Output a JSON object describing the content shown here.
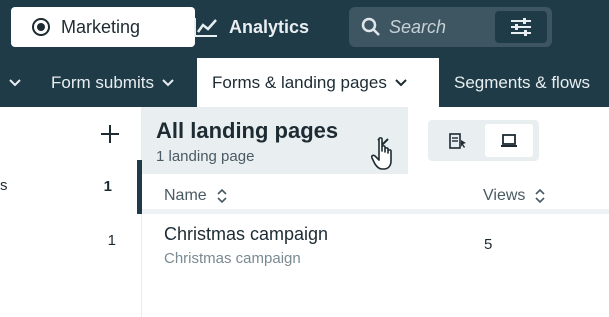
{
  "topbar": {
    "marketing_label": "Marketing",
    "analytics_label": "Analytics",
    "search_placeholder": "Search"
  },
  "subnav": {
    "items": [
      {
        "label": "Form submits",
        "active": false
      },
      {
        "label": "Forms & landing pages",
        "active": true
      },
      {
        "label": "Segments & flows",
        "active": false
      }
    ]
  },
  "sidebar": {
    "rows": [
      {
        "count": "1",
        "active": true
      },
      {
        "count": "1",
        "active": false
      }
    ]
  },
  "main": {
    "title": "All landing pages",
    "subtitle": "1 landing page",
    "columns": {
      "name": "Name",
      "views": "Views"
    },
    "rows": [
      {
        "name": "Christmas campaign",
        "sub": "Christmas campaign",
        "views": "5"
      }
    ]
  },
  "colors": {
    "nav_bg": "#1f3b47",
    "panel_bg": "#e9eff1",
    "accent": "#1f3b47"
  }
}
